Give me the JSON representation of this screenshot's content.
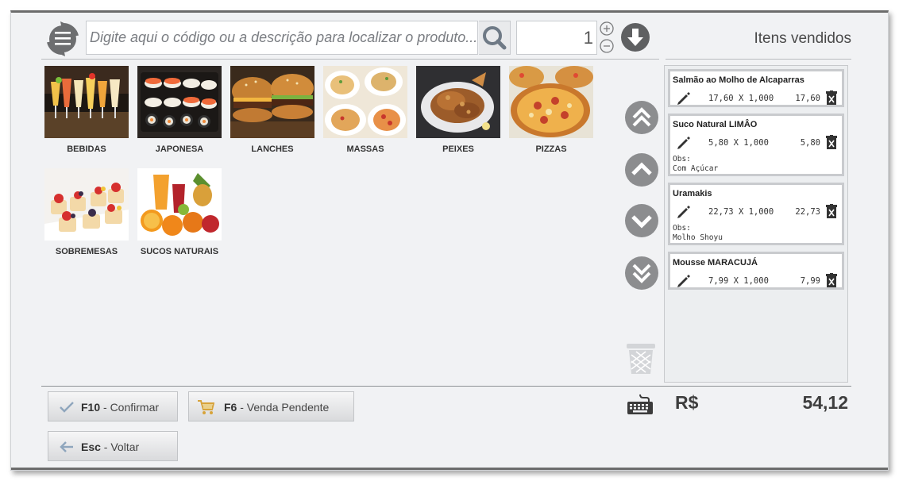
{
  "search": {
    "placeholder": "Digite aqui o código ou a descrição para localizar o produto..."
  },
  "quantity": {
    "value": "1"
  },
  "sold_panel": {
    "title": "Itens vendidos"
  },
  "categories": [
    {
      "label": "BEBIDAS",
      "icon": "drinks-photo"
    },
    {
      "label": "JAPONESA",
      "icon": "sushi-photo"
    },
    {
      "label": "LANCHES",
      "icon": "burger-photo"
    },
    {
      "label": "MASSAS",
      "icon": "pasta-photo"
    },
    {
      "label": "PEIXES",
      "icon": "fish-photo"
    },
    {
      "label": "PIZZAS",
      "icon": "pizza-photo"
    },
    {
      "label": "SOBREMESAS",
      "icon": "dessert-photo"
    },
    {
      "label": "SUCOS NATURAIS",
      "icon": "juice-photo"
    }
  ],
  "sold_items": [
    {
      "name": "Salmão ao Molho de Alcaparras",
      "unit": "17,60",
      "sep": "X",
      "qty": "1,000",
      "total": "17,60",
      "obs_label": "",
      "obs": ""
    },
    {
      "name": "Suco Natural LIMÂO",
      "unit": "5,80",
      "sep": "X",
      "qty": "1,000",
      "total": "5,80",
      "obs_label": "Obs:",
      "obs": "Com Açúcar"
    },
    {
      "name": "Uramakis",
      "unit": "22,73",
      "sep": "X",
      "qty": "1,000",
      "total": "22,73",
      "obs_label": "Obs:",
      "obs": "Molho Shoyu"
    },
    {
      "name": "Mousse MARACUJÁ",
      "unit": "7,99",
      "sep": "X",
      "qty": "1,000",
      "total": "7,99",
      "obs_label": "",
      "obs": ""
    }
  ],
  "buttons": {
    "confirm": {
      "key": "F10",
      "label": " - Confirmar"
    },
    "pending": {
      "key": "F6",
      "label": " - Venda Pendente"
    },
    "back": {
      "key": "Esc",
      "label": " - Voltar"
    }
  },
  "totals": {
    "currency": "R$",
    "value": "54,12"
  },
  "colors": {
    "icon_gray": "#6d6e70",
    "nav_circle": "#8c8d8f",
    "search_icon": "#6f7a86",
    "trash_light": "#d3d5d8"
  }
}
